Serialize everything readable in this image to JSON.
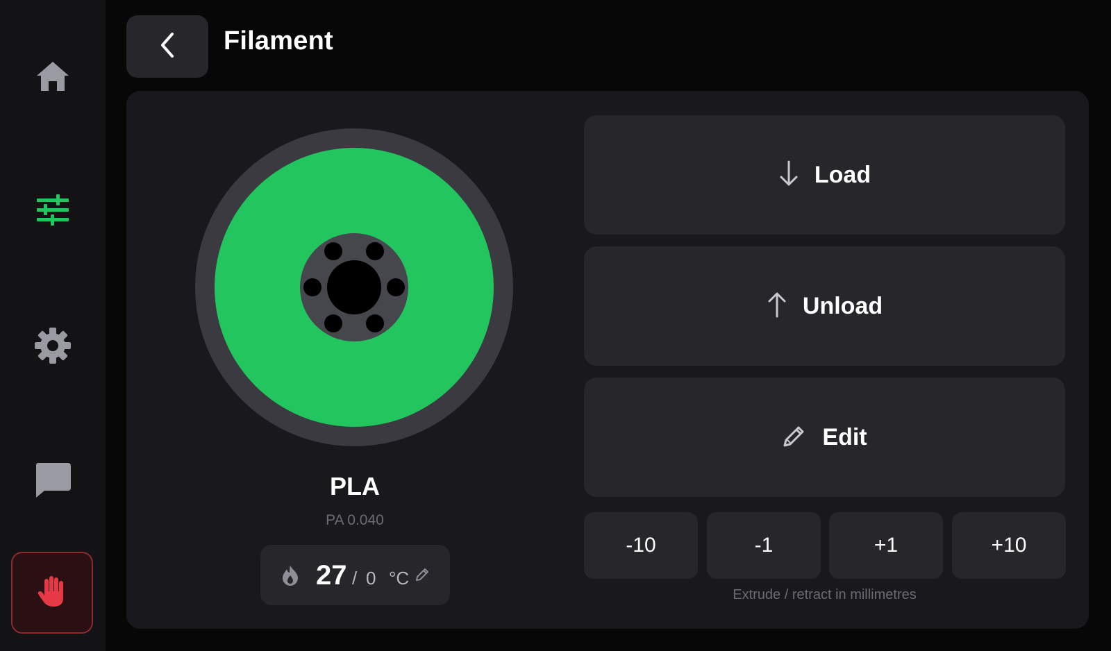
{
  "header": {
    "title": "Filament",
    "back_icon": "chevron-left-icon"
  },
  "sidebar": {
    "items": [
      {
        "name": "home",
        "icon": "home-icon",
        "active": false
      },
      {
        "name": "tune",
        "icon": "sliders-icon",
        "active": true
      },
      {
        "name": "settings",
        "icon": "gear-icon",
        "active": false
      },
      {
        "name": "console",
        "icon": "message-icon",
        "active": false
      }
    ],
    "emergency_stop_icon": "hand-stop-icon"
  },
  "filament": {
    "material": "PLA",
    "pa": "PA 0.040",
    "spool_color": "#22c55e",
    "temperature": {
      "current": "27",
      "separator": "/",
      "target": "0",
      "unit": "°C"
    }
  },
  "actions": {
    "load_label": "Load",
    "unload_label": "Unload",
    "edit_label": "Edit"
  },
  "extrude": {
    "steps": [
      "-10",
      "-1",
      "+1",
      "+10"
    ],
    "hint": "Extrude / retract in millimetres"
  },
  "colors": {
    "accent": "#22c55e",
    "danger": "#e53945",
    "surface": "#26262b",
    "panel": "#19191d",
    "background": "#070708",
    "muted_icon": "#9a9aa2"
  }
}
